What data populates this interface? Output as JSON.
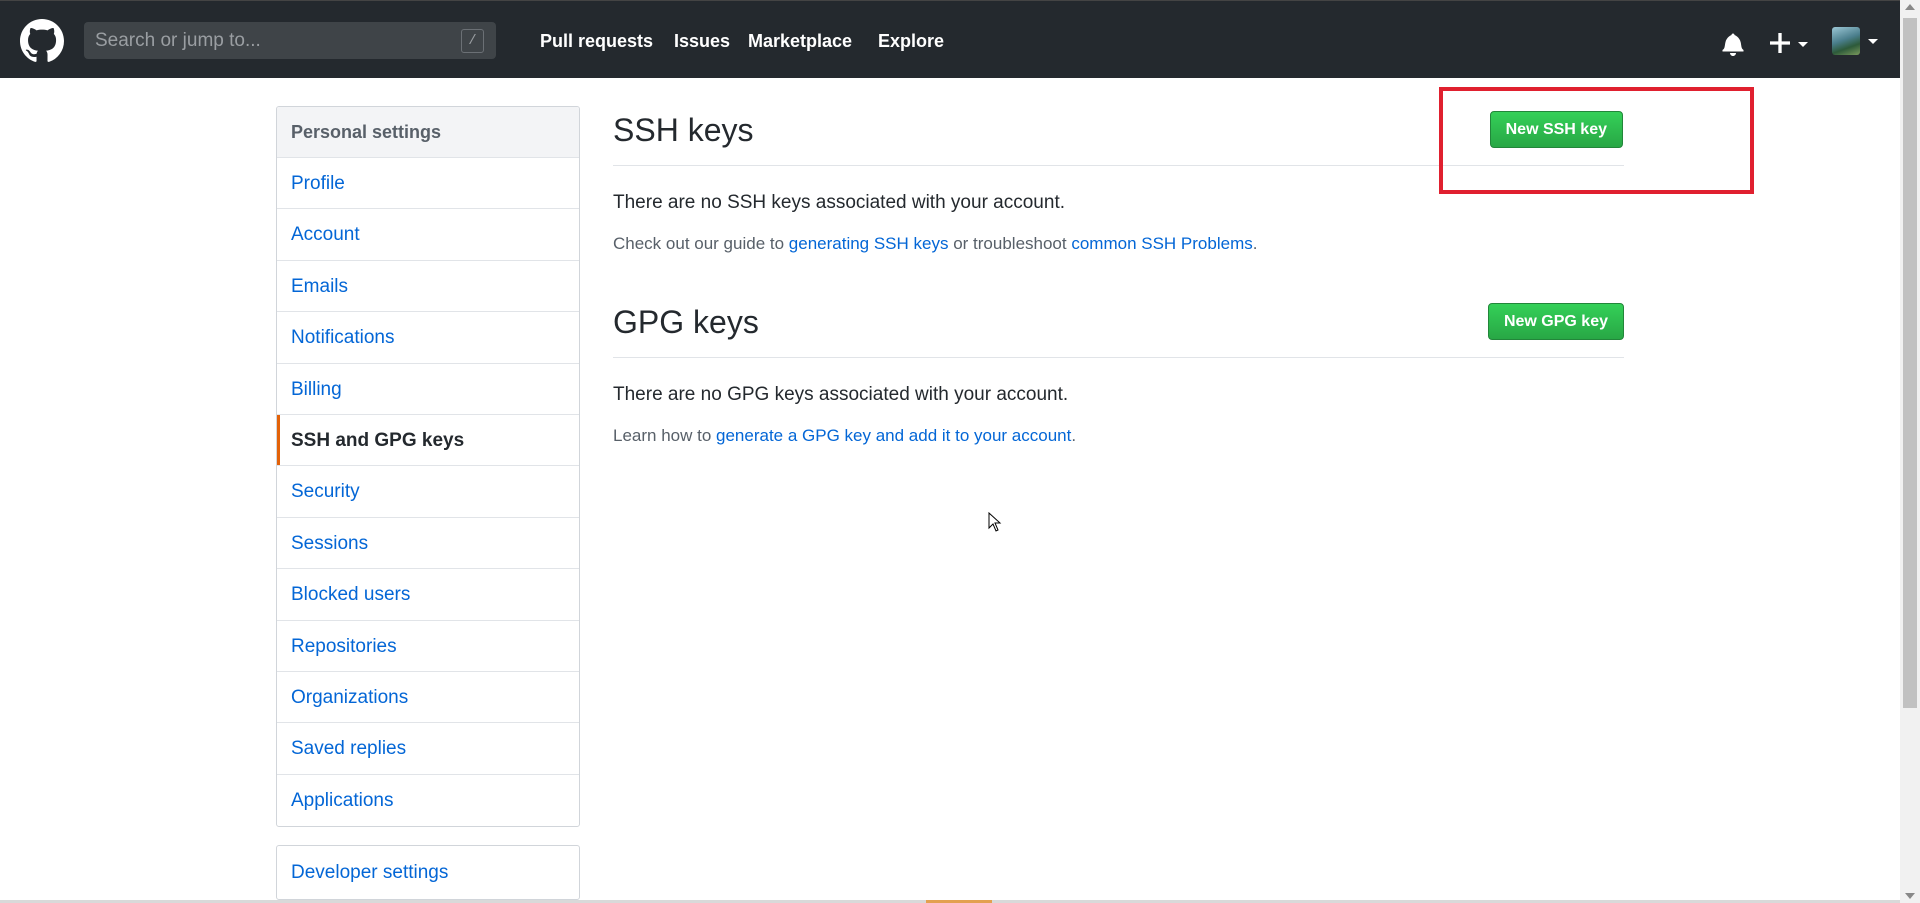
{
  "header": {
    "search_placeholder": "Search or jump to...",
    "search_shortcut": "/",
    "nav": [
      {
        "label": "Pull requests"
      },
      {
        "label": "Issues"
      },
      {
        "label": "Marketplace"
      },
      {
        "label": "Explore"
      }
    ],
    "icons": [
      "github-logo-icon",
      "bell-icon",
      "plus-icon",
      "avatar"
    ]
  },
  "sidebar": {
    "heading": "Personal settings",
    "items": [
      {
        "label": "Profile"
      },
      {
        "label": "Account"
      },
      {
        "label": "Emails"
      },
      {
        "label": "Notifications"
      },
      {
        "label": "Billing"
      },
      {
        "label": "SSH and GPG keys",
        "selected": true
      },
      {
        "label": "Security"
      },
      {
        "label": "Sessions"
      },
      {
        "label": "Blocked users"
      },
      {
        "label": "Repositories"
      },
      {
        "label": "Organizations"
      },
      {
        "label": "Saved replies"
      },
      {
        "label": "Applications"
      }
    ],
    "developer_settings": "Developer settings"
  },
  "ssh": {
    "title": "SSH keys",
    "button": "New SSH key",
    "blank": "There are no SSH keys associated with your account.",
    "note_prefix": "Check out our guide to ",
    "link1": "generating SSH keys",
    "note_middle": " or troubleshoot ",
    "link2": "common SSH Problems",
    "note_suffix": "."
  },
  "gpg": {
    "title": "GPG keys",
    "button": "New GPG key",
    "blank": "There are no GPG keys associated with your account.",
    "note_prefix": "Learn how to ",
    "link1": "generate a GPG key and add it to your account",
    "note_suffix": "."
  },
  "colors": {
    "header_bg": "#24292e",
    "link": "#0366d6",
    "button_green": "#28a745",
    "selected_accent": "#e36209",
    "highlight_box": "#e0202f"
  }
}
